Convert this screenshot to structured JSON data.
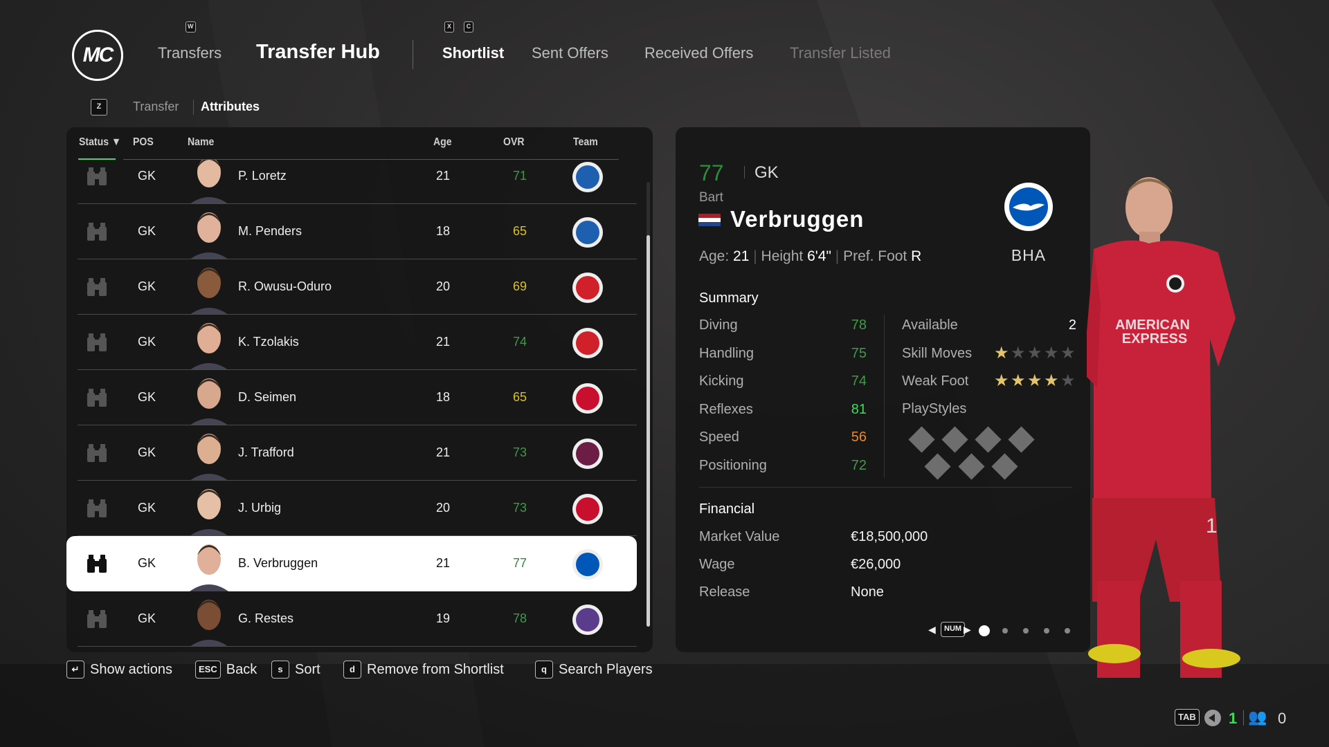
{
  "header": {
    "logo": "MC",
    "keys": {
      "transfers": "W",
      "left_tab": "X",
      "right_tab": "C",
      "subtab": "Z"
    },
    "nav": [
      {
        "label": "Transfers"
      },
      {
        "label": "Transfer Hub",
        "active": true
      }
    ],
    "tabs": [
      {
        "label": "Shortlist",
        "active": true
      },
      {
        "label": "Sent Offers"
      },
      {
        "label": "Received Offers"
      },
      {
        "label": "Transfer Listed",
        "dimmed": true
      }
    ],
    "subtabs": [
      {
        "label": "Transfer"
      },
      {
        "label": "Attributes",
        "active": true
      }
    ]
  },
  "table": {
    "columns": [
      "Status",
      "POS",
      "Name",
      "Age",
      "OVR",
      "Team"
    ],
    "sort_column": "Status",
    "rows": [
      {
        "status": "binoculars-icon",
        "pos": "GK",
        "name": "P. Loretz",
        "age": "21",
        "ovr": "71",
        "ovr_color": "#3f9a4a",
        "team": "FC Luzern"
      },
      {
        "status": "binoculars-icon",
        "pos": "GK",
        "name": "M. Penders",
        "age": "18",
        "ovr": "65",
        "ovr_color": "#d8c12b",
        "team": "Genk"
      },
      {
        "status": "binoculars-icon",
        "pos": "GK",
        "name": "R. Owusu-Oduro",
        "age": "20",
        "ovr": "69",
        "ovr_color": "#d8c12b",
        "team": "AZ"
      },
      {
        "status": "binoculars-icon",
        "pos": "GK",
        "name": "K. Tzolakis",
        "age": "21",
        "ovr": "74",
        "ovr_color": "#3f9a4a",
        "team": "Olympiacos"
      },
      {
        "status": "binoculars-icon",
        "pos": "GK",
        "name": "D. Seimen",
        "age": "18",
        "ovr": "65",
        "ovr_color": "#d8c12b",
        "team": "VfB Stuttgart"
      },
      {
        "status": "binoculars-icon",
        "pos": "GK",
        "name": "J. Trafford",
        "age": "21",
        "ovr": "73",
        "ovr_color": "#3f9a4a",
        "team": "Burnley"
      },
      {
        "status": "binoculars-icon",
        "pos": "GK",
        "name": "J. Urbig",
        "age": "20",
        "ovr": "73",
        "ovr_color": "#3f9a4a",
        "team": "1. FC Köln"
      },
      {
        "status": "binoculars-icon",
        "pos": "GK",
        "name": "B. Verbruggen",
        "age": "21",
        "ovr": "77",
        "ovr_color": "#2f8a3c",
        "team": "Brighton",
        "selected": true
      },
      {
        "status": "binoculars-icon",
        "pos": "GK",
        "name": "G. Restes",
        "age": "19",
        "ovr": "78",
        "ovr_color": "#3f9a4a",
        "team": "Toulouse"
      }
    ],
    "scroll_fraction": 0.88
  },
  "footer_hints": [
    {
      "key": "enter-icon",
      "label": "Show actions"
    },
    {
      "key": "ESC",
      "label": "Back"
    },
    {
      "key": "s",
      "label": "Sort"
    },
    {
      "key": "d",
      "label": "Remove from Shortlist"
    },
    {
      "key": "q",
      "label": "Search Players"
    }
  ],
  "player": {
    "ovr": "77",
    "position": "GK",
    "first_name": "Bart",
    "last_name": "Verbruggen",
    "nationality_flag": "netherlands-flag",
    "club_short": "BHA",
    "age_label": "Age:",
    "age": "21",
    "height_label": "Height",
    "height": "6'4\"",
    "foot_label": "Pref. Foot",
    "foot": "R",
    "summary_title": "Summary",
    "attributes": [
      {
        "label": "Diving",
        "value": "78",
        "color": "#3f9a4a"
      },
      {
        "label": "Handling",
        "value": "75",
        "color": "#3f9a4a"
      },
      {
        "label": "Kicking",
        "value": "74",
        "color": "#3f9a4a"
      },
      {
        "label": "Reflexes",
        "value": "81",
        "color": "#3ddc5a"
      },
      {
        "label": "Speed",
        "value": "56",
        "color": "#e88a2a"
      },
      {
        "label": "Positioning",
        "value": "72",
        "color": "#3f9a4a"
      }
    ],
    "available_label": "Available",
    "available": "2",
    "skill_moves_label": "Skill Moves",
    "skill_moves": 1,
    "weak_foot_label": "Weak Foot",
    "weak_foot": 4,
    "playstyles_label": "PlayStyles",
    "playstyles_slots": 7,
    "financial_title": "Financial",
    "financial": [
      {
        "label": "Market Value",
        "value": "€18,500,000"
      },
      {
        "label": "Wage",
        "value": "€26,000"
      },
      {
        "label": "Release",
        "value": "None"
      }
    ],
    "pager": {
      "key": "NUM",
      "pages": 5,
      "current": 1
    }
  },
  "kit": {
    "sponsor_line1": "AMERICAN",
    "sponsor_line2": "EXPRESS",
    "number": "1"
  },
  "status_bar": {
    "key": "TAB",
    "speaker_count": "1",
    "players_count": "0"
  },
  "colors": {
    "accent_green": "#3ddc5a",
    "selected_row": "#ffffff",
    "panel": "#161616",
    "kit_red": "#c8223a"
  }
}
